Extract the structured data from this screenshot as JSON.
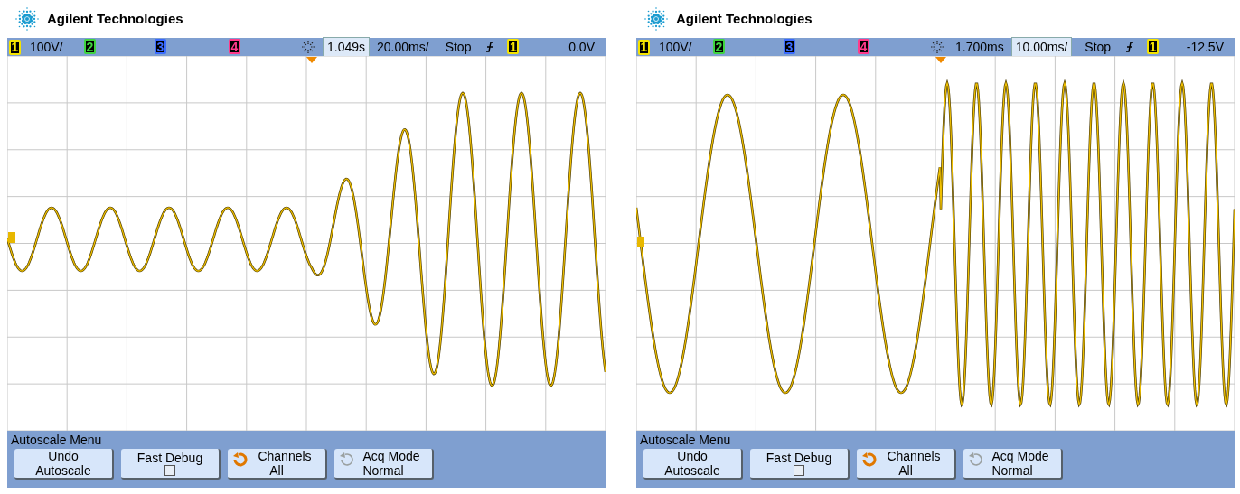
{
  "screens": [
    {
      "brand": "Agilent Technologies",
      "status_bar": {
        "channels": [
          {
            "number": "1",
            "color": "#f5e400",
            "scale": "100V/"
          },
          {
            "number": "2",
            "color": "#3fd43f"
          },
          {
            "number": "3",
            "color": "#3a6bff"
          },
          {
            "number": "4",
            "color": "#ff3a8a"
          }
        ],
        "delay": {
          "value": "1.049s",
          "selected": true
        },
        "timebase": {
          "value": "20.00ms/",
          "selected": false
        },
        "run_state": "Stop",
        "trigger_source": {
          "number": "1",
          "color": "#f5e400"
        },
        "trigger_level": "0.0V"
      },
      "menu": {
        "title": "Autoscale Menu",
        "buttons": [
          {
            "kind": "text",
            "lines": [
              "Undo",
              "Autoscale"
            ]
          },
          {
            "kind": "checkbox",
            "label": "Fast Debug",
            "checked": false
          },
          {
            "kind": "cycle",
            "lines": [
              "Channels",
              "All"
            ],
            "disabled": false
          },
          {
            "kind": "cycle",
            "lines": [
              "Acq Mode",
              "Normal"
            ],
            "disabled": true
          }
        ]
      }
    },
    {
      "brand": "Agilent Technologies",
      "status_bar": {
        "channels": [
          {
            "number": "1",
            "color": "#f5e400",
            "scale": "100V/"
          },
          {
            "number": "2",
            "color": "#3fd43f"
          },
          {
            "number": "3",
            "color": "#3a6bff"
          },
          {
            "number": "4",
            "color": "#ff3a8a"
          }
        ],
        "delay": {
          "value": "1.700ms",
          "selected": false
        },
        "timebase": {
          "value": "10.00ms/",
          "selected": true
        },
        "run_state": "Stop",
        "trigger_source": {
          "number": "1",
          "color": "#f5e400"
        },
        "trigger_level": "-12.5V"
      },
      "menu": {
        "title": "Autoscale Menu",
        "buttons": [
          {
            "kind": "text",
            "lines": [
              "Undo",
              "Autoscale"
            ]
          },
          {
            "kind": "checkbox",
            "label": "Fast Debug",
            "checked": false
          },
          {
            "kind": "cycle",
            "lines": [
              "Channels",
              "All"
            ],
            "disabled": false
          },
          {
            "kind": "cycle",
            "lines": [
              "Acq Mode",
              "Normal"
            ],
            "disabled": true
          }
        ]
      }
    }
  ]
}
